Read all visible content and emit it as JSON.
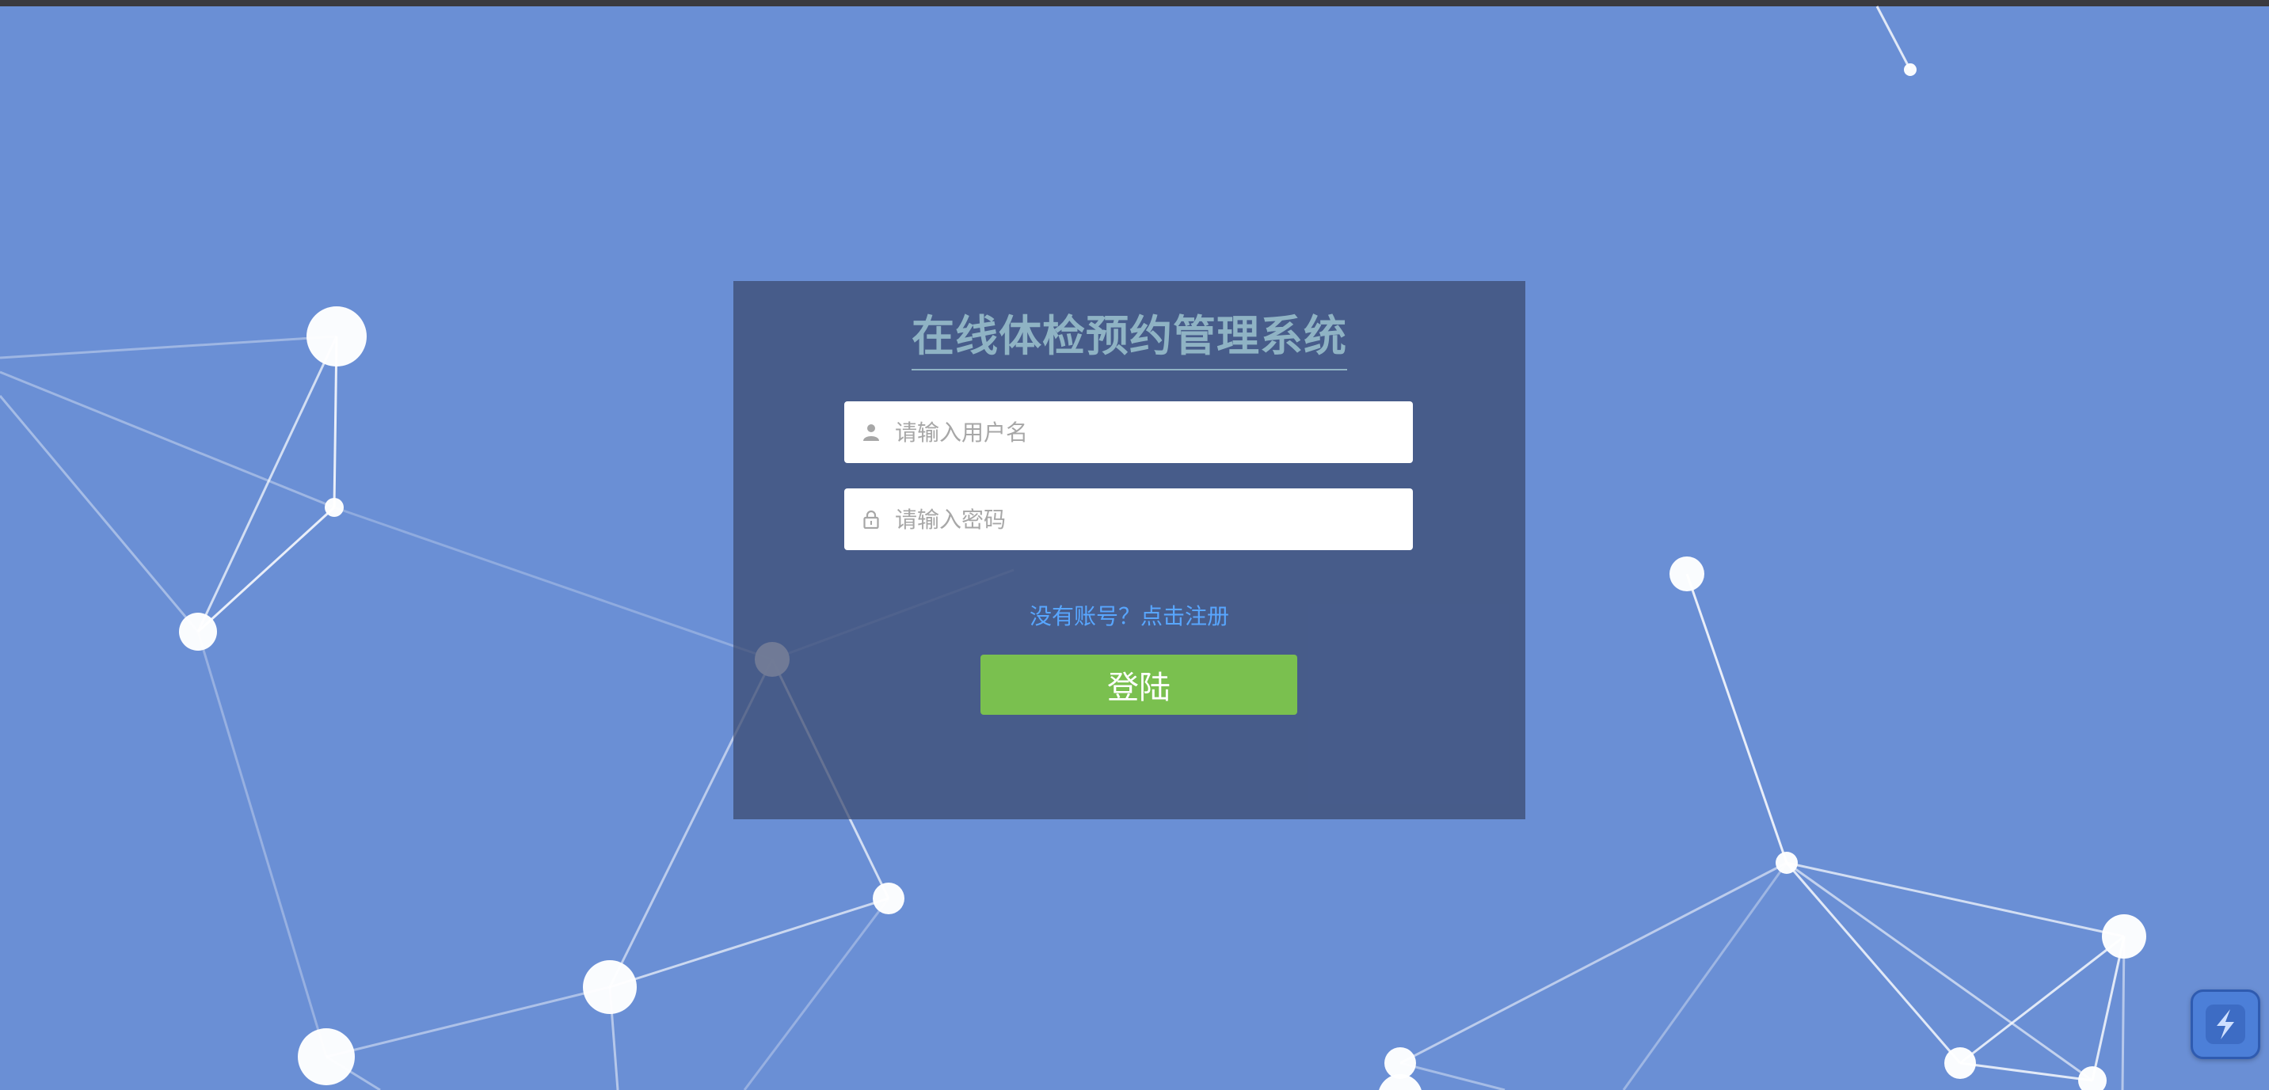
{
  "colors": {
    "background": "#6a8fd5",
    "panel": "#3a486e",
    "title": "#8fb3c4",
    "link": "#58a6ff",
    "button": "#7ac04f"
  },
  "login": {
    "title": "在线体检预约管理系统",
    "username_placeholder": "请输入用户名",
    "password_placeholder": "请输入密码",
    "register_link": "没有账号？点击注册",
    "submit_label": "登陆"
  },
  "icons": {
    "username": "user-icon",
    "password": "lock-icon",
    "widget": "lightning-icon"
  }
}
